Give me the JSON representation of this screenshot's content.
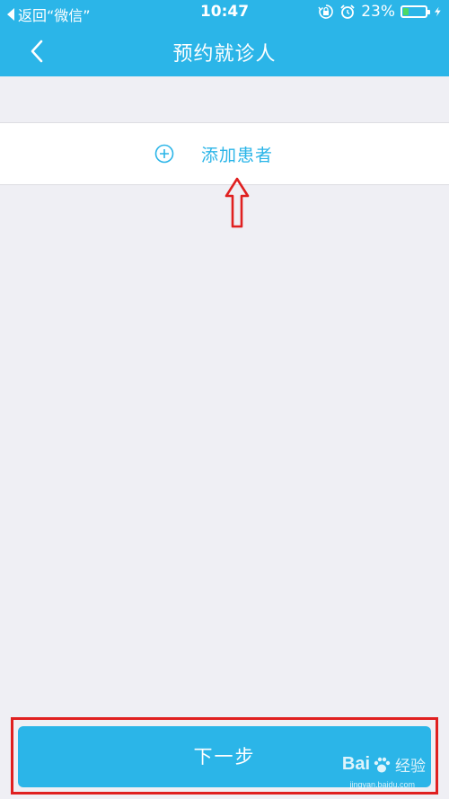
{
  "status_bar": {
    "back_text": "返回“微信”",
    "time": "10:47",
    "battery_text": "23%",
    "battery_level": 0.23,
    "icons": [
      "back-triangle-icon",
      "lock-rotation-icon",
      "alarm-icon",
      "battery-icon",
      "charging-icon"
    ]
  },
  "nav": {
    "title": "预约就诊人",
    "back_icon": "chevron-left-icon"
  },
  "add_patient": {
    "label": "添加患者",
    "icon": "plus-circle-icon"
  },
  "footer": {
    "next_label": "下一步"
  },
  "watermark": {
    "brand_text": "Bai",
    "brand_suffix": "经验",
    "url": "jingyan.baidu.com"
  },
  "colors": {
    "primary": "#2bb5e8",
    "background": "#efeff4",
    "annotation": "#e02020",
    "battery_fill": "#4cd964"
  }
}
